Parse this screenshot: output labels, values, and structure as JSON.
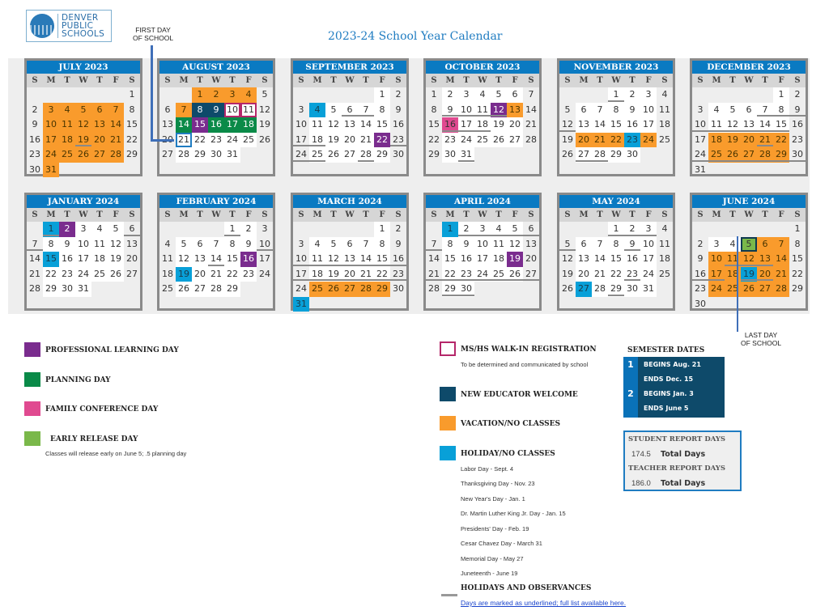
{
  "header": {
    "logo_lines": [
      "DENVER",
      "PUBLIC",
      "SCHOOLS"
    ],
    "title": "2023-24 School Year Calendar",
    "first_day_callout": [
      "FIRST DAY",
      "OF SCHOOL"
    ],
    "last_day_callout": [
      "LAST DAY",
      "OF SCHOOL"
    ]
  },
  "weekday_labels": [
    "S",
    "M",
    "T",
    "W",
    "T",
    "F",
    "S"
  ],
  "colors": {
    "header_blue": "#0a7ac2",
    "vacation_orange": "#f99b2c",
    "holiday_blue": "#08a0d8",
    "professional_purple": "#7a2c8e",
    "planning_green": "#0a8a48",
    "conference_pink": "#e04a90",
    "early_release_green": "#7ab84a",
    "new_educator_navy": "#0e4a6a",
    "walkin_magenta": "#b5276a"
  },
  "months": [
    {
      "name": "JULY 2023",
      "start": 6,
      "days": 31,
      "white": [],
      "styles": {
        "or": [
          3,
          4,
          5,
          6,
          7,
          10,
          11,
          12,
          13,
          14,
          17,
          18,
          19,
          20,
          21,
          24,
          25,
          26,
          27,
          28,
          31
        ]
      },
      "underline": [
        19
      ]
    },
    {
      "name": "AUGUST 2023",
      "start": 2,
      "days": 31,
      "white": [
        22,
        23,
        24,
        25,
        28,
        29,
        30,
        31
      ],
      "styles": {
        "or": [
          1,
          2,
          3,
          4,
          7
        ],
        "nv": [
          8,
          9
        ],
        "om": [
          10,
          11
        ],
        "gr": [
          14,
          16,
          17,
          18
        ],
        "pu": [
          15
        ],
        "ob": [
          21
        ]
      },
      "underline": []
    },
    {
      "name": "SEPTEMBER 2023",
      "start": 5,
      "days": 30,
      "white": [
        1,
        5,
        6,
        7,
        8,
        11,
        12,
        13,
        14,
        15,
        18,
        19,
        20,
        21,
        25,
        26,
        27,
        28,
        29
      ],
      "styles": {
        "bl": [
          4
        ],
        "pu": [
          22
        ]
      },
      "underline": [
        6,
        7,
        17,
        18,
        23,
        24,
        25,
        28
      ]
    },
    {
      "name": "OCTOBER 2023",
      "start": 0,
      "days": 31,
      "white": [
        2,
        3,
        4,
        5,
        6,
        9,
        10,
        11,
        17,
        18,
        19,
        20,
        23,
        24,
        25,
        26,
        27,
        30,
        31
      ],
      "styles": {
        "pu": [
          12
        ],
        "or": [
          13
        ],
        "pk": [
          16
        ]
      },
      "underline": [
        9,
        10,
        11,
        12,
        16,
        17,
        18,
        31
      ]
    },
    {
      "name": "NOVEMBER 2023",
      "start": 3,
      "days": 30,
      "white": [
        1,
        2,
        3,
        6,
        7,
        8,
        9,
        10,
        13,
        14,
        15,
        16,
        17,
        27,
        28,
        29,
        30
      ],
      "styles": {
        "or": [
          20,
          21,
          22,
          24
        ],
        "bl": [
          23
        ]
      },
      "underline": [
        1,
        12,
        27,
        28
      ]
    },
    {
      "name": "DECEMBER 2023",
      "start": 5,
      "days": 31,
      "white": [
        1,
        4,
        5,
        6,
        7,
        8,
        11,
        12,
        13,
        14,
        15
      ],
      "styles": {
        "or": [
          18,
          19,
          20,
          21,
          22,
          25,
          26,
          27,
          28,
          29
        ]
      },
      "underline": [
        7,
        8,
        9,
        10,
        11,
        12,
        13,
        14,
        15,
        21,
        24,
        25,
        26,
        27,
        28,
        29,
        30,
        31
      ]
    },
    {
      "name": "JANUARY 2024",
      "start": 1,
      "days": 31,
      "white": [
        3,
        4,
        5,
        8,
        9,
        10,
        11,
        12,
        16,
        17,
        18,
        19,
        22,
        23,
        24,
        25,
        26,
        29,
        30,
        31
      ],
      "styles": {
        "bl": [
          1,
          15
        ],
        "pu": [
          2
        ]
      },
      "underline": [
        1,
        6,
        7
      ]
    },
    {
      "name": "FEBRUARY 2024",
      "start": 4,
      "days": 29,
      "white": [
        1,
        2,
        5,
        6,
        7,
        8,
        9,
        12,
        13,
        14,
        15,
        20,
        21,
        22,
        23,
        26,
        27,
        28,
        29
      ],
      "styles": {
        "pu": [
          16
        ],
        "bl": [
          19
        ]
      },
      "underline": [
        1,
        10,
        14
      ]
    },
    {
      "name": "MARCH 2024",
      "start": 5,
      "days": 31,
      "white": [
        1,
        4,
        5,
        6,
        7,
        8,
        11,
        12,
        13,
        14,
        15,
        18,
        19,
        20,
        21,
        22
      ],
      "styles": {
        "or": [
          25,
          26,
          27,
          28,
          29
        ],
        "bl": [
          31
        ]
      },
      "underline": [
        10,
        11,
        12,
        13,
        14,
        15,
        16,
        17,
        18,
        19,
        20,
        21,
        22,
        23
      ]
    },
    {
      "name": "APRIL 2024",
      "start": 1,
      "days": 30,
      "white": [
        2,
        3,
        4,
        5,
        8,
        9,
        10,
        11,
        12,
        15,
        16,
        17,
        18,
        22,
        23,
        24,
        25,
        26,
        29,
        30
      ],
      "styles": {
        "bl": [
          1
        ],
        "pu": [
          19
        ]
      },
      "underline": [
        2,
        3,
        4,
        5,
        6,
        7,
        21,
        22,
        23,
        24,
        25,
        26,
        27,
        29,
        30
      ]
    },
    {
      "name": "MAY 2024",
      "start": 3,
      "days": 31,
      "white": [
        1,
        2,
        3,
        6,
        7,
        8,
        9,
        10,
        13,
        14,
        15,
        16,
        17,
        20,
        21,
        22,
        23,
        24,
        28,
        29,
        30,
        31
      ],
      "styles": {
        "bl": [
          27
        ]
      },
      "underline": [
        1,
        2,
        3,
        5,
        9,
        23,
        29
      ]
    },
    {
      "name": "JUNE 2024",
      "start": 6,
      "days": 30,
      "white": [
        3,
        4
      ],
      "styles": {
        "lg": [
          5
        ],
        "or": [
          6,
          7,
          10,
          11,
          12,
          13,
          14,
          17,
          18,
          20,
          21,
          24,
          25,
          26,
          27,
          28
        ],
        "bl": [
          19
        ]
      },
      "underline": [
        11,
        12,
        13,
        16,
        17,
        19,
        20
      ]
    }
  ],
  "legend_left": [
    {
      "key": "pu",
      "label": "PROFESSIONAL LEARNING DAY"
    },
    {
      "key": "gr",
      "label": "PLANNING DAY"
    },
    {
      "key": "pk",
      "label": "FAMILY CONFERENCE DAY"
    },
    {
      "key": "lg",
      "label": "EARLY RELEASE DAY",
      "note": "Classes will release early on June 5; .5 planning day"
    }
  ],
  "legend_right": [
    {
      "key": "om",
      "label": "MS/HS WALK-IN REGISTRATION",
      "note": "To be determined and communicated by school"
    },
    {
      "key": "nv",
      "label": "NEW EDUCATOR WELCOME"
    },
    {
      "key": "or",
      "label": "VACATION/NO CLASSES"
    },
    {
      "key": "bl",
      "label": "HOLIDAY/NO CLASSES"
    }
  ],
  "holidays": [
    "Labor Day - Sept. 4",
    "Thanksgiving Day - Nov. 23",
    "New Year's Day - Jan. 1",
    "Dr. Martin Luther King Jr. Day - Jan. 15",
    "Presidents' Day - Feb. 19",
    "Cesar Chavez Day - March 31",
    "Memorial Day - May 27",
    "Juneteenth - June 19"
  ],
  "observances": {
    "label": "HOLIDAYS AND OBSERVANCES",
    "link": "Days are marked as underlined; full list available here."
  },
  "semester": {
    "title": "SEMESTER DATES",
    "rows": [
      {
        "num": "1",
        "text": "BEGINS Aug. 21"
      },
      {
        "num": "",
        "text": "ENDS Dec. 15"
      },
      {
        "num": "2",
        "text": "BEGINS Jan. 3"
      },
      {
        "num": "",
        "text": "ENDS June 5"
      }
    ]
  },
  "report_days": {
    "student_title": "STUDENT REPORT DAYS",
    "student_value": "174.5",
    "teacher_title": "TEACHER REPORT DAYS",
    "teacher_value": "186.0",
    "total_label": "Total Days"
  }
}
